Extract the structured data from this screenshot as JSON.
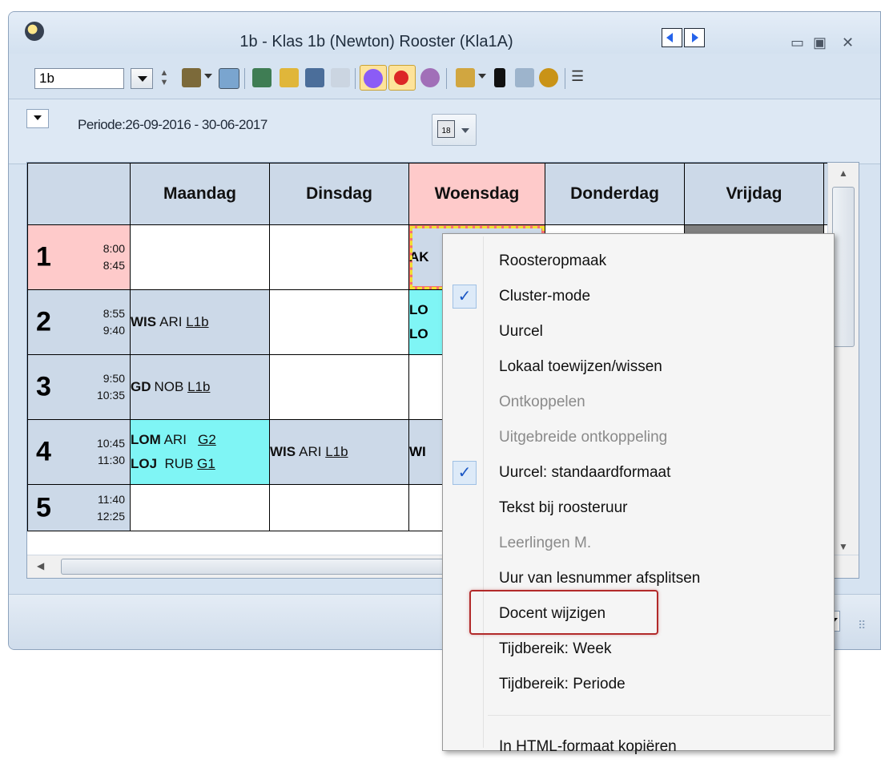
{
  "window": {
    "title": "1b - Klas 1b (Newton)  Rooster  (Kla1A)",
    "class_combo_value": "1b"
  },
  "period_bar": {
    "period_label": "Periode:26-09-2016 - 30-06-2017",
    "calendar_icon_text": "18"
  },
  "timetable": {
    "days": [
      "Maandag",
      "Dinsdag",
      "Woensdag",
      "Donderdag",
      "Vrijdag"
    ],
    "hours": [
      {
        "num": "1",
        "start": "8:00",
        "end": "8:45"
      },
      {
        "num": "2",
        "start": "8:55",
        "end": "9:40"
      },
      {
        "num": "3",
        "start": "9:50",
        "end": "10:35"
      },
      {
        "num": "4",
        "start": "10:45",
        "end": "11:30"
      },
      {
        "num": "5",
        "start": "11:40",
        "end": "12:25"
      }
    ],
    "cells": {
      "h1_wed": "AK",
      "h2_mon": {
        "subject": "WIS",
        "teacher": "ARI",
        "room": "L1b"
      },
      "h2_wed_line1": "LO",
      "h2_wed_line2": "LO",
      "h3_mon": {
        "subject": "GD",
        "teacher": "NOB",
        "room": "L1b"
      },
      "h4_mon_line1": {
        "subject": "LOM",
        "teacher": "ARI",
        "room": "G2"
      },
      "h4_mon_line2": {
        "subject": "LOJ",
        "teacher": "RUB",
        "room": "G1"
      },
      "h4_tue": {
        "subject": "WIS",
        "teacher": "ARI",
        "room": "L1b"
      },
      "h4_wed": "WI"
    }
  },
  "context_menu": {
    "items": [
      {
        "label": "Roosteropmaak",
        "checked": false,
        "enabled": true
      },
      {
        "label": "Cluster-mode",
        "checked": true,
        "enabled": true
      },
      {
        "label": "Uurcel",
        "checked": false,
        "enabled": true
      },
      {
        "label": "Lokaal toewijzen/wissen",
        "checked": false,
        "enabled": true
      },
      {
        "label": "Ontkoppelen",
        "checked": false,
        "enabled": false
      },
      {
        "label": "Uitgebreide ontkoppeling",
        "checked": false,
        "enabled": false
      },
      {
        "label": "Uurcel: standaardformaat",
        "checked": true,
        "enabled": true
      },
      {
        "label": "Tekst bij roosteruur",
        "checked": false,
        "enabled": true
      },
      {
        "label": "Leerlingen M.",
        "checked": false,
        "enabled": false
      },
      {
        "label": "Uur van lesnummer afsplitsen",
        "checked": false,
        "enabled": true
      },
      {
        "label": "Docent wijzigen",
        "checked": false,
        "enabled": true,
        "highlighted": true
      },
      {
        "label": "Tijdbereik: Week",
        "checked": false,
        "enabled": true
      },
      {
        "label": "Tijdbereik: Periode",
        "checked": false,
        "enabled": true
      },
      {
        "label": "In HTML-formaat kopiëren",
        "checked": false,
        "enabled": true
      }
    ],
    "check_glyph": "✓"
  },
  "colors": {
    "today_header": "#fecaca",
    "cell_blue": "#ccd9e8",
    "cell_cyan": "#7ff5f5",
    "highlight_box": "#b22a2a"
  }
}
